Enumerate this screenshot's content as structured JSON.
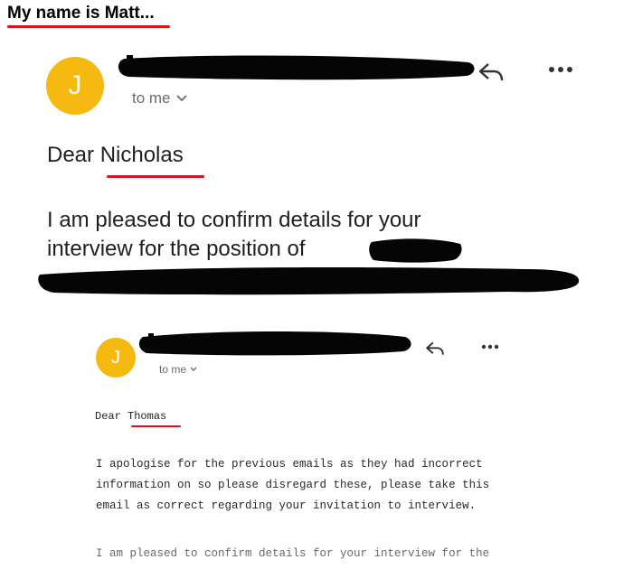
{
  "caption": {
    "text": "My name is Matt..."
  },
  "email_1": {
    "avatar_letter": "J",
    "recipient": "to me",
    "greeting_prefix": "Dear ",
    "greeting_name": "Nicholas",
    "body_lines": [
      "I am pleased to confirm details for your",
      "interview for the position of"
    ]
  },
  "email_2": {
    "avatar_letter": "J",
    "recipient": "to me",
    "greeting_prefix": "Dear ",
    "greeting_name": "Thomas",
    "paragraph_lines": [
      "I apologise for the previous emails as they had incorrect",
      "information on so please disregard these, please take this",
      "email as correct regarding your invitation to interview."
    ],
    "paragraph_2": "I am pleased to confirm details for your interview for the"
  },
  "colors": {
    "avatar": "#f5b90f",
    "annotation_red": "#e0101a",
    "redaction": "#050505"
  },
  "icons": {
    "reply": "reply-arrow-icon",
    "more": "more-options-icon",
    "chevron": "chevron-down-icon"
  }
}
